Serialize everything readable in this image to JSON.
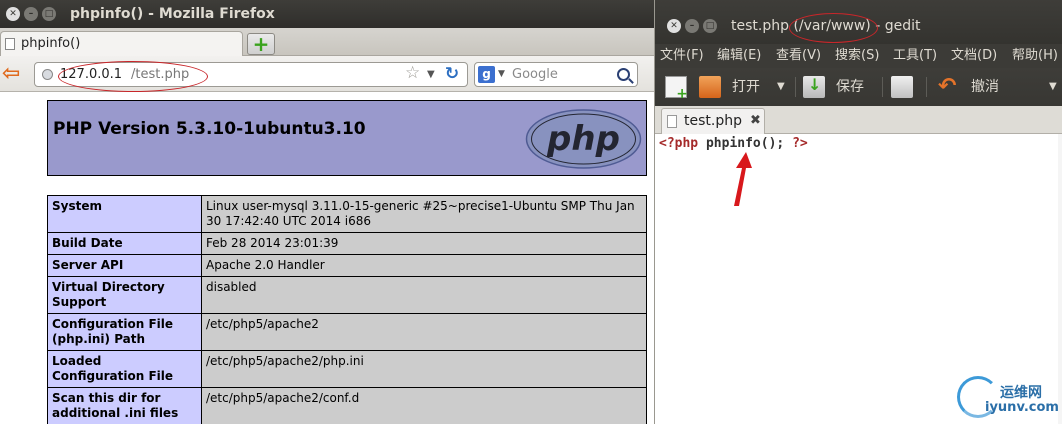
{
  "firefox": {
    "window_title": "phpinfo() - Mozilla Firefox",
    "tab_label": "phpinfo()",
    "new_tab_symbol": "+",
    "url_host": "127.0.0.1",
    "url_path": "/test.php",
    "search_engine": "g",
    "search_placeholder": "Google"
  },
  "phpinfo": {
    "version_heading": "PHP Version 5.3.10-1ubuntu3.10",
    "logo_text": "php",
    "rows": [
      {
        "key": "System",
        "value": "Linux user-mysql 3.11.0-15-generic #25~precise1-Ubuntu SMP Thu Jan 30 17:42:40 UTC 2014 i686"
      },
      {
        "key": "Build Date",
        "value": "Feb 28 2014 23:01:39"
      },
      {
        "key": "Server API",
        "value": "Apache 2.0 Handler"
      },
      {
        "key": "Virtual Directory Support",
        "value": "disabled"
      },
      {
        "key": "Configuration File (php.ini) Path",
        "value": "/etc/php5/apache2"
      },
      {
        "key": "Loaded Configuration File",
        "value": "/etc/php5/apache2/php.ini"
      },
      {
        "key": "Scan this dir for additional .ini files",
        "value": "/etc/php5/apache2/conf.d"
      }
    ]
  },
  "gedit": {
    "title_file": "test.php",
    "title_path": "(/var/www)",
    "title_app": "- gedit",
    "menu": [
      "文件(F)",
      "编辑(E)",
      "查看(V)",
      "搜索(S)",
      "工具(T)",
      "文档(D)",
      "帮助(H)"
    ],
    "toolbar": {
      "open": "打开",
      "save": "保存",
      "undo": "撤消"
    },
    "tab_label": "test.php",
    "code": {
      "open_tag": "<?php",
      "call": "phpinfo();",
      "close_tag": "?>"
    }
  },
  "watermark": {
    "cn": "运维网",
    "en": "iyunv.com"
  },
  "colors": {
    "php_header": "#9999cc",
    "php_key": "#ccccff",
    "php_value": "#cccccc",
    "annotation": "#c8262a",
    "code_keyword": "#a52a2a"
  }
}
